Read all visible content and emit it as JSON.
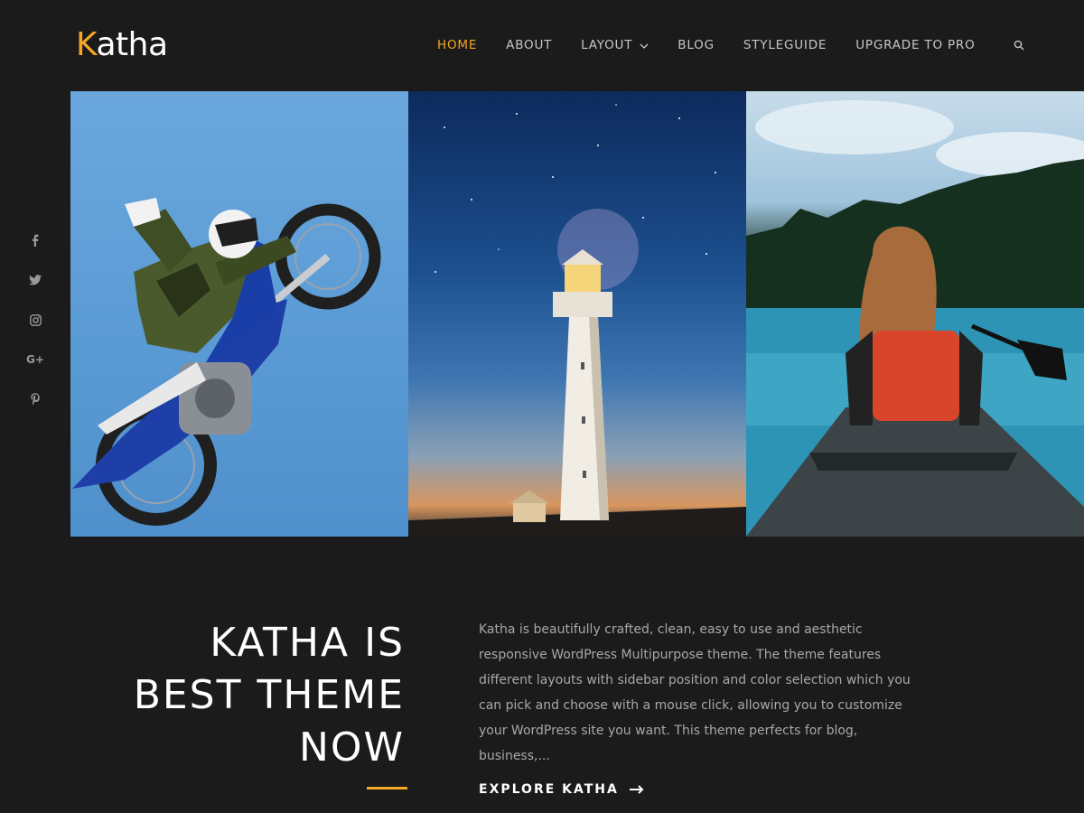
{
  "brand": {
    "logo_first_letter": "K",
    "logo_rest": "atha",
    "accent_color": "#f5a623"
  },
  "nav": {
    "items": [
      {
        "label": "HOME",
        "active": true
      },
      {
        "label": "ABOUT",
        "active": false
      },
      {
        "label": "LAYOUT",
        "active": false,
        "has_dropdown": true
      },
      {
        "label": "BLOG",
        "active": false
      },
      {
        "label": "STYLEGUIDE",
        "active": false
      },
      {
        "label": "UPGRADE TO PRO",
        "active": false
      }
    ],
    "search_icon": "search-icon"
  },
  "social": {
    "icons": [
      "facebook-icon",
      "twitter-icon",
      "instagram-icon",
      "google-plus-icon",
      "pinterest-icon"
    ],
    "google_plus_text": "G+"
  },
  "hero": {
    "images": [
      "motocross-rider-image",
      "lighthouse-image",
      "kayak-woman-image"
    ]
  },
  "intro": {
    "headline_lines": [
      "KATHA IS",
      "BEST THEME",
      "NOW"
    ],
    "description": "Katha is beautifully crafted, clean, easy to use and aesthetic responsive WordPress Multipurpose theme. The theme features different layouts with sidebar position and color selection which you can pick and choose with a mouse click, allowing you to customize your WordPress site you want. This theme perfects for blog, business,...",
    "cta_label": "EXPLORE KATHA"
  }
}
